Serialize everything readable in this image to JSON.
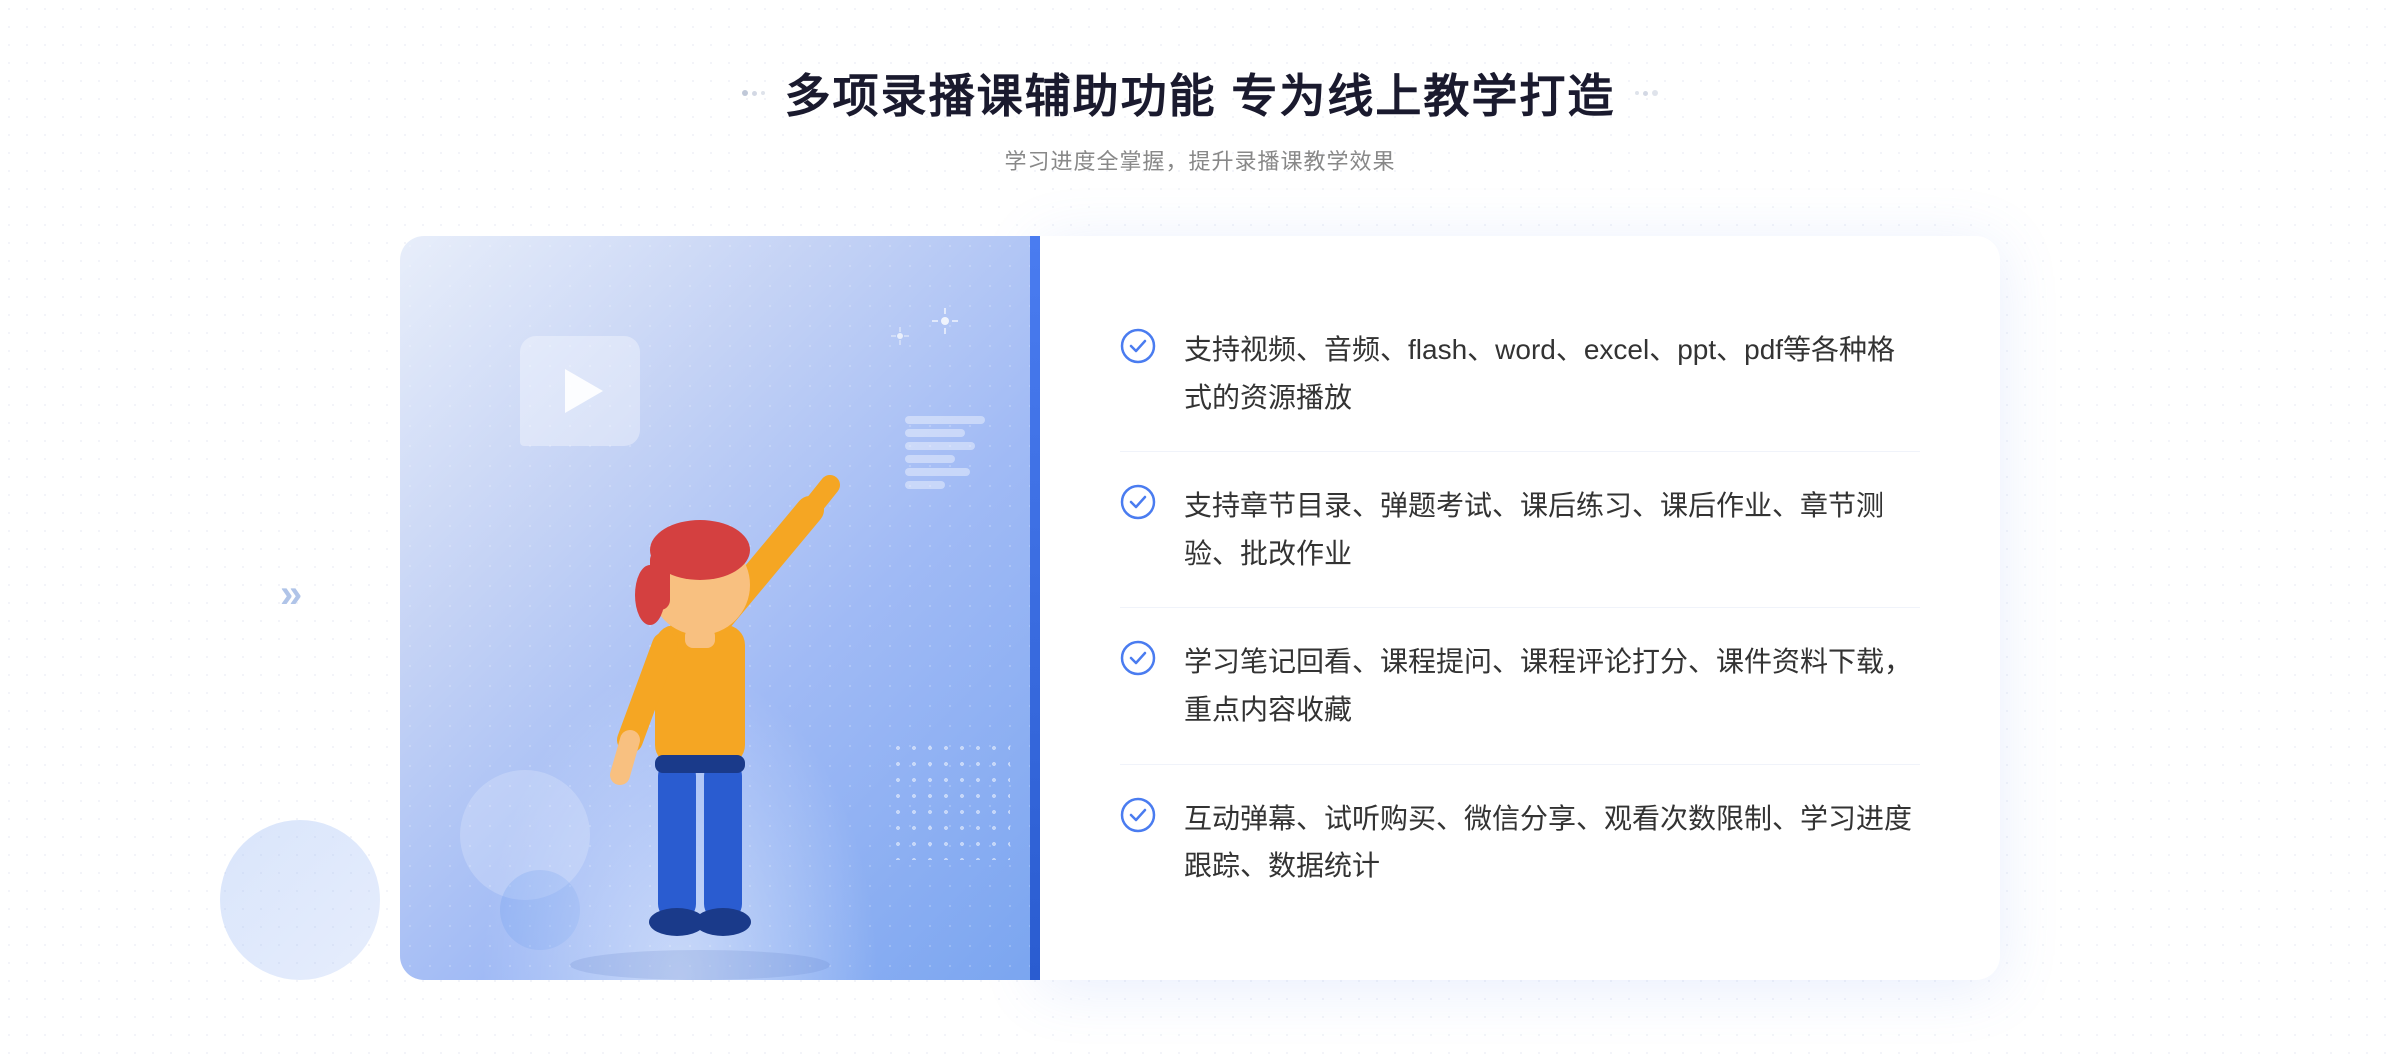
{
  "page": {
    "background": "#ffffff"
  },
  "header": {
    "main_title": "多项录播课辅助功能 专为线上教学打造",
    "sub_title": "学习进度全掌握，提升录播课教学效果",
    "decorator_dots": [
      "•",
      "•",
      "•"
    ]
  },
  "features": [
    {
      "id": 1,
      "text": "支持视频、音频、flash、word、excel、ppt、pdf等各种格式的资源播放"
    },
    {
      "id": 2,
      "text": "支持章节目录、弹题考试、课后练习、课后作业、章节测验、批改作业"
    },
    {
      "id": 3,
      "text": "学习笔记回看、课程提问、课程评论打分、课件资料下载，重点内容收藏"
    },
    {
      "id": 4,
      "text": "互动弹幕、试听购买、微信分享、观看次数限制、学习进度跟踪、数据统计"
    }
  ],
  "illustration": {
    "play_button_label": "▶",
    "left_arrows": "»"
  },
  "colors": {
    "primary_blue": "#4a7cf0",
    "light_blue": "#a0baf5",
    "text_dark": "#1a1a2e",
    "text_gray": "#888888",
    "text_body": "#333333",
    "check_color": "#4a7cf0"
  }
}
